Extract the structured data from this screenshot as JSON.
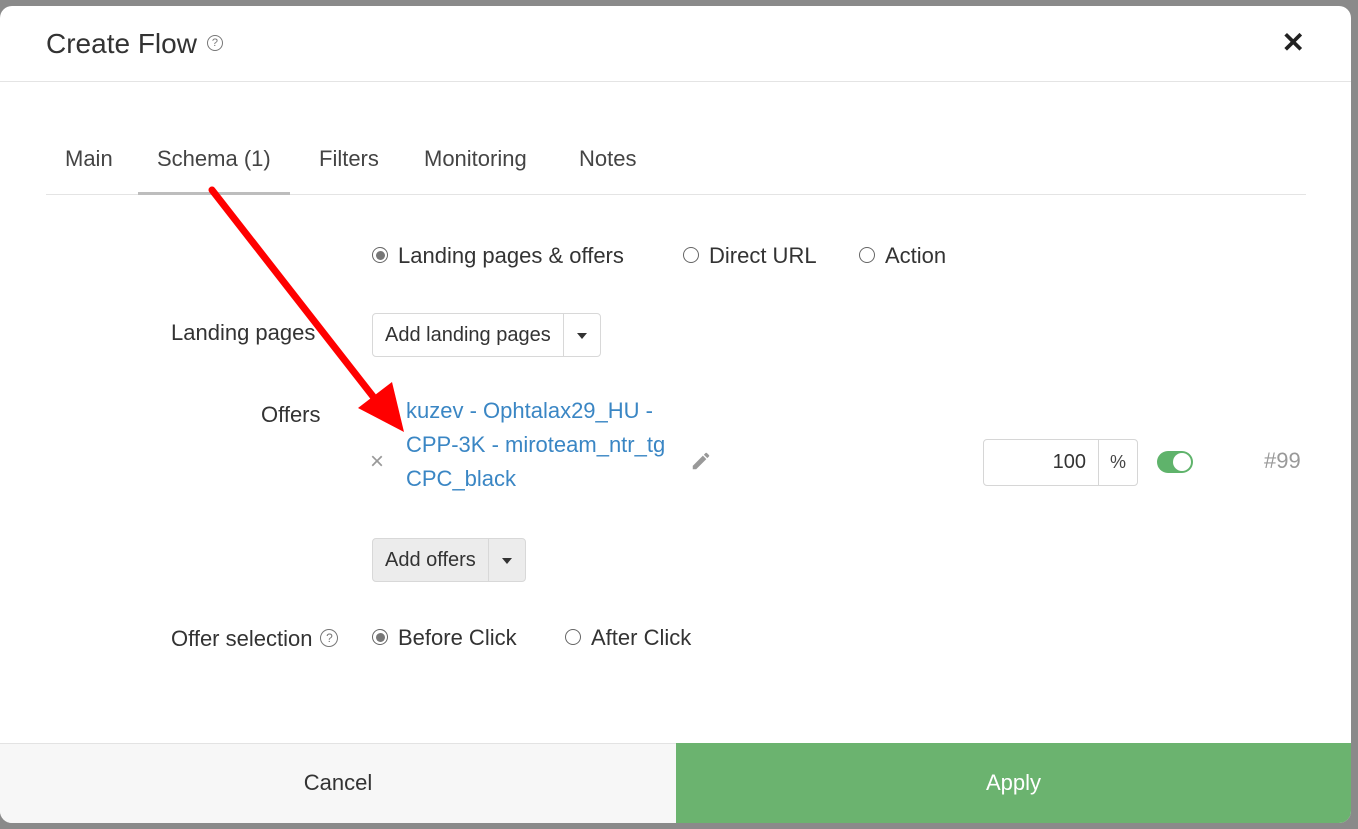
{
  "dialog": {
    "title": "Create Flow",
    "help_icon": "question-circle-icon",
    "close_icon": "close-icon",
    "close_glyph": "✕"
  },
  "tabs": [
    {
      "label": "Main"
    },
    {
      "label": "Schema (1)",
      "active": true
    },
    {
      "label": "Filters"
    },
    {
      "label": "Monitoring"
    },
    {
      "label": "Notes"
    }
  ],
  "schema_type": {
    "options": [
      "Landing pages & offers",
      "Direct URL",
      "Action"
    ],
    "selected": "Landing pages & offers"
  },
  "landing_pages": {
    "label": "Landing pages",
    "add_button": "Add landing pages"
  },
  "offers": {
    "label": "Offers",
    "remove_glyph": "×",
    "item": {
      "name": "kuzev - Ophtalax29_HU - CPP-3K - miroteam_ntr_tgCPC_black",
      "weight": "100",
      "weight_unit": "%",
      "enabled": true,
      "id": "#99"
    },
    "add_button": "Add offers"
  },
  "offer_selection": {
    "label": "Offer selection",
    "options": [
      "Before Click",
      "After Click"
    ],
    "selected": "Before Click"
  },
  "footer": {
    "cancel": "Cancel",
    "apply": "Apply"
  },
  "colors": {
    "apply_green": "#6bb36f",
    "toggle_green": "#5fb36b",
    "link_blue": "#3a86c4",
    "annotation_arrow": "#ff0000"
  }
}
